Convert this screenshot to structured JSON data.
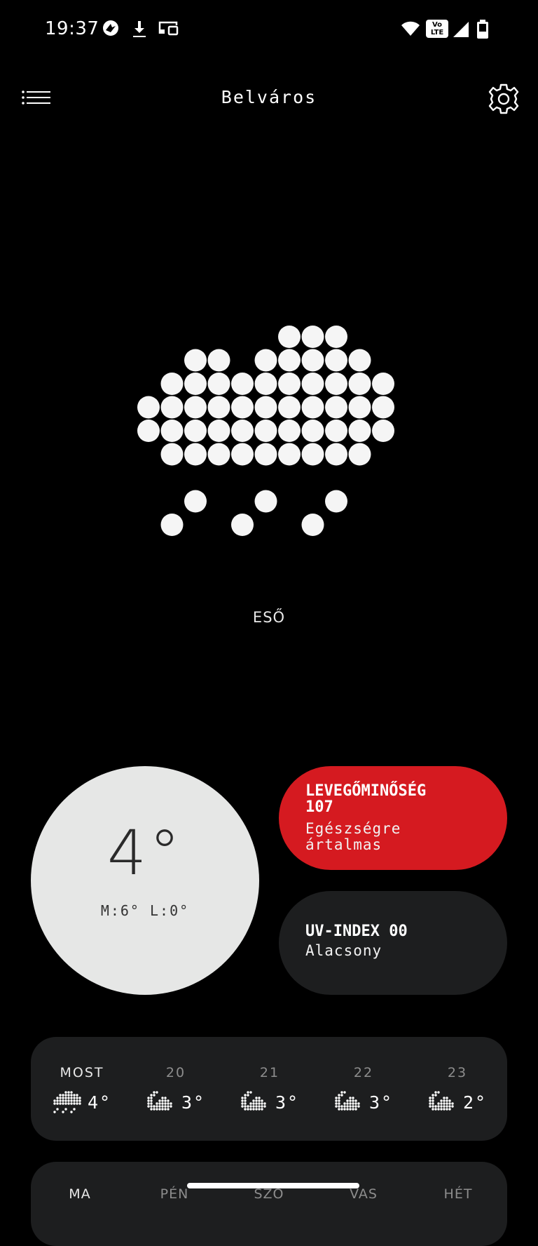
{
  "status_bar": {
    "time": "19:37",
    "volte_label_1": "Vo",
    "volte_label_2": "LTE",
    "icons": [
      "app-notification-icon",
      "download-icon",
      "cast-icon",
      "wifi-icon",
      "volte-icon",
      "signal-icon",
      "battery-icon"
    ]
  },
  "header": {
    "title": "Belváros",
    "menu_icon": "menu-icon",
    "settings_icon": "settings-gear-icon"
  },
  "current": {
    "icon": "rain-cloud-icon",
    "condition": "ESŐ",
    "temperature": "4°",
    "high_low": "M:6° L:0°"
  },
  "air_quality": {
    "title": "LEVEGŐMINŐSÉG",
    "value": "107",
    "status_line1": "Egészségre",
    "status_line2": "ártalmas",
    "color": "#d51a20"
  },
  "uv": {
    "title": "UV-INDEX 00",
    "status": "Alacsony"
  },
  "hourly": [
    {
      "label": "MOST",
      "icon": "rain-icon",
      "temp": "4°"
    },
    {
      "label": "20",
      "icon": "moon-cloud-icon",
      "temp": "3°"
    },
    {
      "label": "21",
      "icon": "moon-cloud-icon",
      "temp": "3°"
    },
    {
      "label": "22",
      "icon": "moon-cloud-icon",
      "temp": "3°"
    },
    {
      "label": "23",
      "icon": "moon-cloud-icon",
      "temp": "2°"
    }
  ],
  "daily_tabs": [
    "MA",
    "PÉN",
    "SZO",
    "VAS",
    "HÉT"
  ]
}
